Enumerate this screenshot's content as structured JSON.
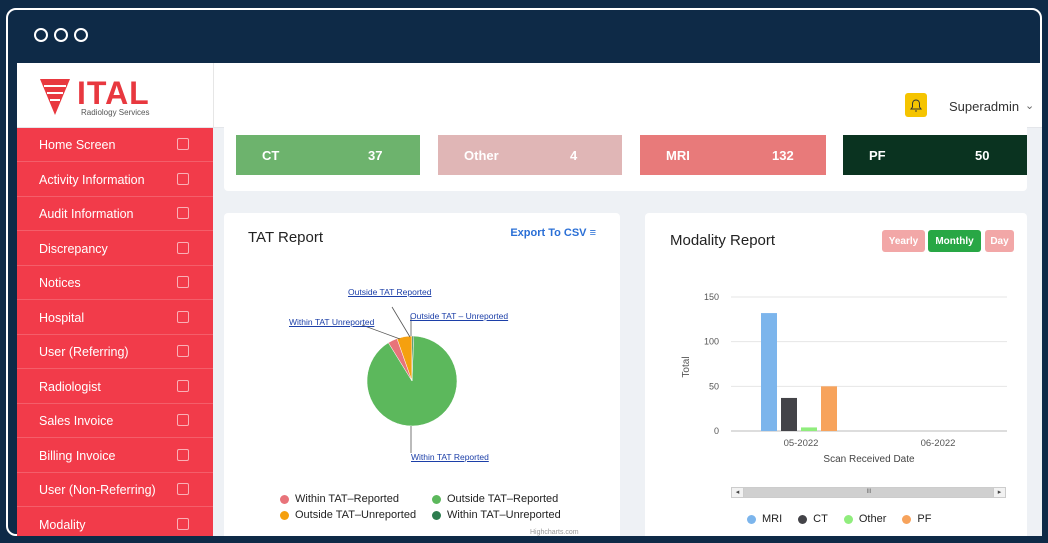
{
  "brand": {
    "name": "ITAL",
    "subtitle": "Radiology Services"
  },
  "header": {
    "username": "Superadmin",
    "bell_color": "#f5c400"
  },
  "sidebar": {
    "items": [
      {
        "label": "Home Screen",
        "icon": "monitor-icon"
      },
      {
        "label": "Activity Information",
        "icon": "bar-chart-icon"
      },
      {
        "label": "Audit Information",
        "icon": "book-icon"
      },
      {
        "label": "Discrepancy",
        "icon": "user-icon"
      },
      {
        "label": "Notices",
        "icon": "edit-icon"
      },
      {
        "label": "Hospital",
        "icon": "file-icon"
      },
      {
        "label": "User (Referring)",
        "icon": "file-icon"
      },
      {
        "label": "Radiologist",
        "icon": "file-icon"
      },
      {
        "label": "Sales Invoice",
        "icon": "calculator-icon"
      },
      {
        "label": "Billing Invoice",
        "icon": "calculator-icon"
      },
      {
        "label": "User (Non-Referring)",
        "icon": "calculator-icon"
      },
      {
        "label": "Modality",
        "icon": "calculator-icon"
      }
    ]
  },
  "modality_counts": [
    {
      "label": "CT",
      "value": "37",
      "color": "#6db36d"
    },
    {
      "label": "Other",
      "value": "4",
      "color": "#e0b6b6"
    },
    {
      "label": "MRI",
      "value": "132",
      "color": "#e87a7a"
    },
    {
      "label": "PF",
      "value": "50",
      "color": "#0a3320"
    }
  ],
  "tat_report": {
    "title": "TAT Report",
    "export_label": "Export To CSV",
    "pie_labels": {
      "outside_reported": "Outside TAT Reported",
      "within_unreported": "Within TAT Unreported",
      "outside_unreported": "Outside TAT – Unreported",
      "within_reported": "Within TAT Reported"
    },
    "legend": [
      {
        "label": "Within TAT–Reported",
        "color": "#e8737a"
      },
      {
        "label": "Outside TAT–Reported",
        "color": "#5cb85c"
      },
      {
        "label": "Outside TAT–Unreported",
        "color": "#f5a00f"
      },
      {
        "label": "Within TAT–Unreported",
        "color": "#2e7d4f"
      }
    ],
    "credit": "Highcharts.com"
  },
  "modality_report": {
    "title": "Modality Report",
    "buttons": [
      {
        "label": "Yearly",
        "color": "#f2a7a7"
      },
      {
        "label": "Monthly",
        "color": "#28a745"
      },
      {
        "label": "Day",
        "color": "#f2a7a7"
      }
    ],
    "scroll_thumb": "III",
    "scroll_left": "◂",
    "scroll_right": "▸"
  },
  "chart_data": [
    {
      "type": "pie",
      "title": "TAT Report",
      "slices": [
        {
          "label": "Within TAT Reported",
          "value": 90.6,
          "color": "#5cb85c"
        },
        {
          "label": "Within TAT Unreported",
          "value": 3.4,
          "color": "#e8737a"
        },
        {
          "label": "Outside TAT Reported",
          "value": 5.4,
          "color": "#f5a00f"
        },
        {
          "label": "Outside TAT – Unreported",
          "value": 0.6,
          "color": "#2e7d4f"
        }
      ]
    },
    {
      "type": "bar",
      "title": "Modality Report",
      "categories": [
        "05-2022",
        "06-2022"
      ],
      "series": [
        {
          "name": "MRI",
          "values": [
            132,
            0
          ],
          "color": "#7cb5ec"
        },
        {
          "name": "CT",
          "values": [
            37,
            0
          ],
          "color": "#434348"
        },
        {
          "name": "Other",
          "values": [
            4,
            0
          ],
          "color": "#90ed7d"
        },
        {
          "name": "PF",
          "values": [
            50,
            0
          ],
          "color": "#f7a35c"
        }
      ],
      "xlabel": "Scan Received Date",
      "ylabel": "Total",
      "ylim": [
        0,
        150
      ],
      "yticks": [
        0,
        50,
        100,
        150
      ]
    }
  ]
}
